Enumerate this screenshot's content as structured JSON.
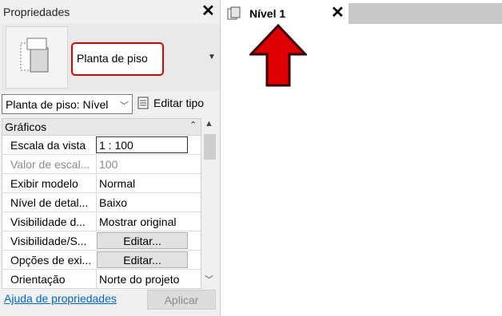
{
  "panel": {
    "title": "Propriedades",
    "type_name": "Planta de piso",
    "filter_value": "Planta de piso: Nível",
    "edit_type_label": "Editar tipo",
    "group": "Gráficos",
    "rows": [
      {
        "name": "Escala da vista",
        "value": "1 : 100"
      },
      {
        "name": "Valor de escal...",
        "value": "100"
      },
      {
        "name": "Exibir modelo",
        "value": "Normal"
      },
      {
        "name": "Nível de detal...",
        "value": "Baixo"
      },
      {
        "name": "Visibilidade d...",
        "value": "Mostrar original"
      },
      {
        "name": "Visibilidade/S...",
        "value": "Editar..."
      },
      {
        "name": "Opções de exi...",
        "value": "Editar..."
      },
      {
        "name": "Orientação",
        "value": "Norte do projeto"
      }
    ],
    "help_link": "Ajuda de propriedades",
    "apply_label": "Aplicar"
  },
  "tab": {
    "label": "Nível 1"
  },
  "colors": {
    "highlight_red": "#e00000",
    "arrow_red": "#dd0000",
    "link_blue": "#0066cc"
  }
}
